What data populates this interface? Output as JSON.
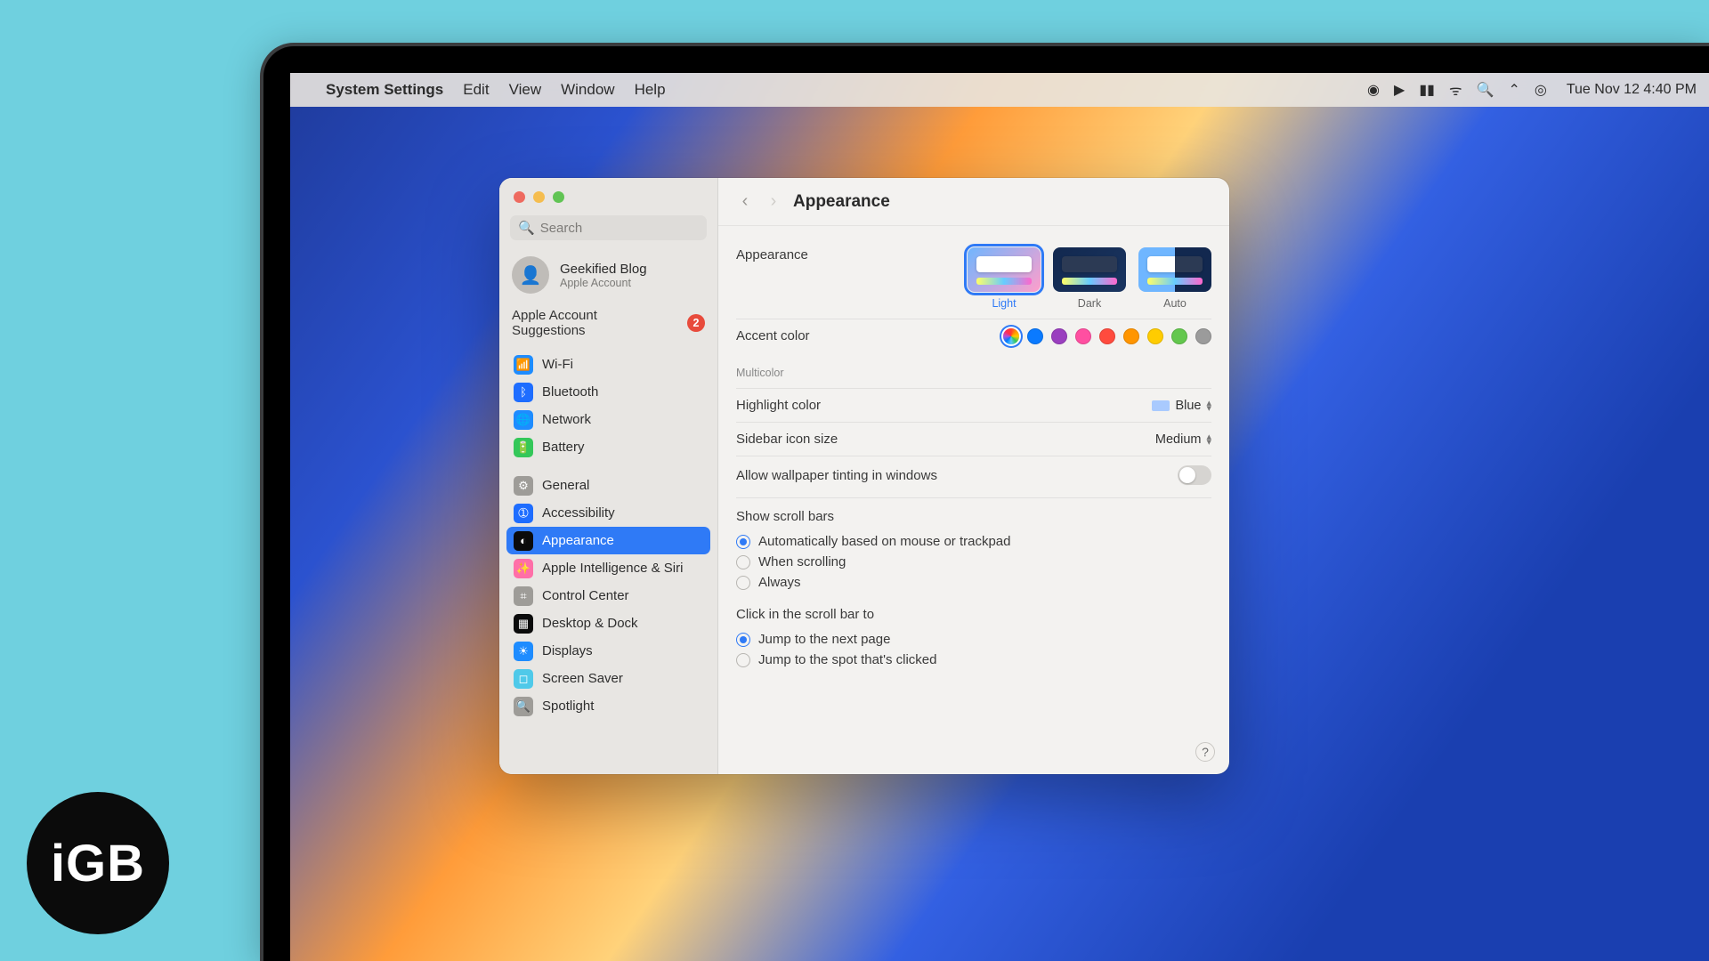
{
  "menubar": {
    "apple_glyph": "",
    "app_name": "System Settings",
    "menus": [
      "Edit",
      "View",
      "Window",
      "Help"
    ],
    "clock": "Tue Nov 12  4:40 PM"
  },
  "window": {
    "traffic_colors": [
      "#ee6a5f",
      "#f5bd4f",
      "#61c454"
    ],
    "search_placeholder": "Search",
    "account": {
      "name": "Geekified Blog",
      "subtitle": "Apple Account"
    },
    "suggestions": {
      "label": "Apple Account Suggestions",
      "badge": "2"
    },
    "sidebar_groups": [
      [
        {
          "id": "wifi",
          "label": "Wi-Fi",
          "color": "#1e8cff",
          "glyph": "📶"
        },
        {
          "id": "bluetooth",
          "label": "Bluetooth",
          "color": "#1e6dff",
          "glyph": "ᛒ"
        },
        {
          "id": "network",
          "label": "Network",
          "color": "#1e8cff",
          "glyph": "🌐"
        },
        {
          "id": "battery",
          "label": "Battery",
          "color": "#34c759",
          "glyph": "🔋"
        }
      ],
      [
        {
          "id": "general",
          "label": "General",
          "color": "#9e9c98",
          "glyph": "⚙"
        },
        {
          "id": "accessibility",
          "label": "Accessibility",
          "color": "#1e6dff",
          "glyph": "➀"
        },
        {
          "id": "appearance",
          "label": "Appearance",
          "color": "#0b0b0b",
          "glyph": "◐",
          "selected": true
        },
        {
          "id": "appleint",
          "label": "Apple Intelligence & Siri",
          "color": "#ff6fa8",
          "glyph": "✨"
        },
        {
          "id": "controlcenter",
          "label": "Control Center",
          "color": "#9e9c98",
          "glyph": "⌗"
        },
        {
          "id": "desktopdock",
          "label": "Desktop & Dock",
          "color": "#0b0b0b",
          "glyph": "▦"
        },
        {
          "id": "displays",
          "label": "Displays",
          "color": "#1e8cff",
          "glyph": "☀"
        },
        {
          "id": "screensaver",
          "label": "Screen Saver",
          "color": "#4fc9e9",
          "glyph": "◻"
        },
        {
          "id": "spotlight",
          "label": "Spotlight",
          "color": "#9e9c98",
          "glyph": "🔍"
        }
      ]
    ],
    "title": "Appearance"
  },
  "appearance": {
    "row_appearance_label": "Appearance",
    "modes": [
      {
        "id": "light",
        "label": "Light",
        "selected": true
      },
      {
        "id": "dark",
        "label": "Dark",
        "selected": false
      },
      {
        "id": "auto",
        "label": "Auto",
        "selected": false
      }
    ],
    "accent_label": "Accent color",
    "accent_caption": "Multicolor",
    "accent_colors": [
      {
        "id": "multicolor",
        "css": "conic-gradient(#ff3b30,#ff9500,#ffcc00,#34c759,#5ac8fa,#007aff,#af52de,#ff2d55,#ff3b30)",
        "selected": true
      },
      {
        "id": "blue",
        "css": "#0a7aff"
      },
      {
        "id": "purple",
        "css": "#9a3fbf"
      },
      {
        "id": "pink",
        "css": "#ff4fa1"
      },
      {
        "id": "red",
        "css": "#ff4b3e"
      },
      {
        "id": "orange",
        "css": "#ff9500"
      },
      {
        "id": "yellow",
        "css": "#ffcc00"
      },
      {
        "id": "green",
        "css": "#63c74d"
      },
      {
        "id": "graphite",
        "css": "#9b9b9b"
      }
    ],
    "highlight_label": "Highlight color",
    "highlight_value": "Blue",
    "sidebar_icon_label": "Sidebar icon size",
    "sidebar_icon_value": "Medium",
    "tinting_label": "Allow wallpaper tinting in windows",
    "tinting_on": false,
    "scroll_bars": {
      "title": "Show scroll bars",
      "options": [
        {
          "label": "Automatically based on mouse or trackpad",
          "selected": true
        },
        {
          "label": "When scrolling",
          "selected": false
        },
        {
          "label": "Always",
          "selected": false
        }
      ]
    },
    "scroll_click": {
      "title": "Click in the scroll bar to",
      "options": [
        {
          "label": "Jump to the next page",
          "selected": true
        },
        {
          "label": "Jump to the spot that's clicked",
          "selected": false
        }
      ]
    },
    "help_glyph": "?"
  },
  "badge_logo": "iGB"
}
